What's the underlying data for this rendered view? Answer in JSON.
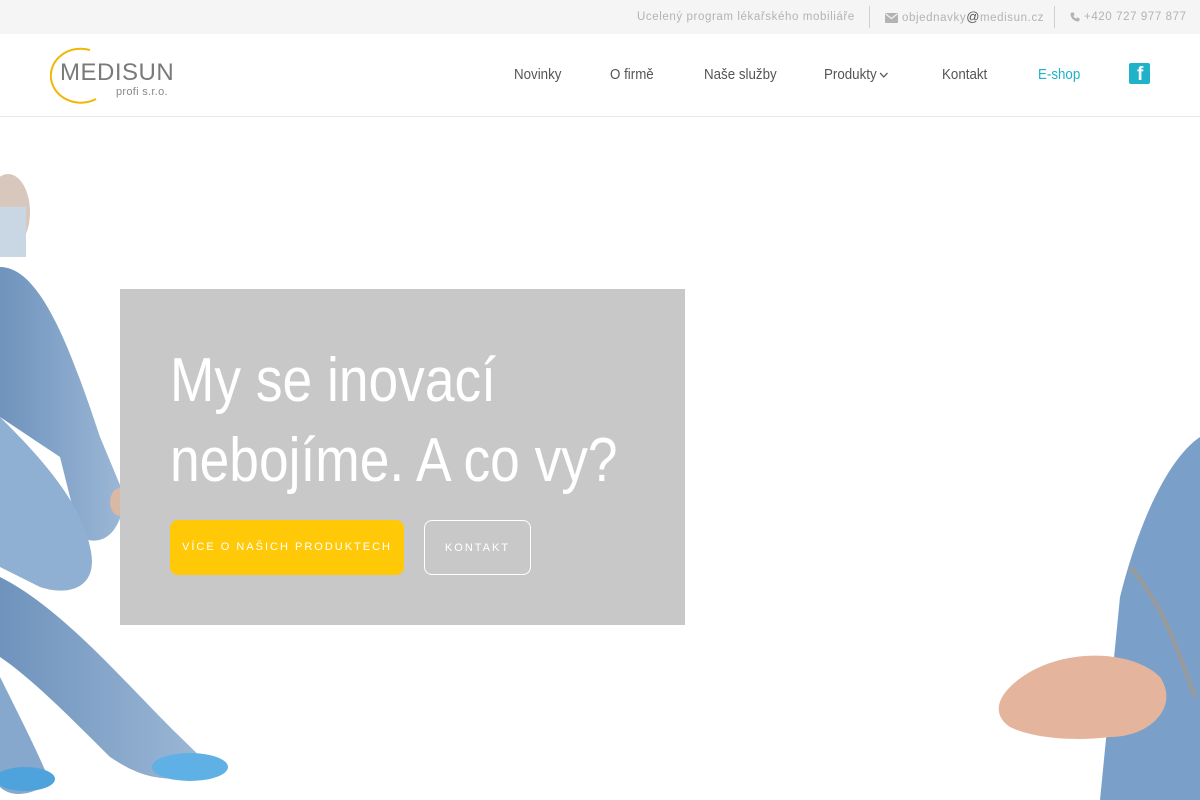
{
  "topbar": {
    "tagline": "Ucelený program lékařského mobiliáře",
    "email_user": "objednavky",
    "email_at": "@",
    "email_domain": "medisun.cz",
    "phone": "+420 727 977 877"
  },
  "logo": {
    "wordmark": "MEDISUN",
    "subtitle": "profi s.r.o."
  },
  "nav": {
    "items": [
      {
        "label": "Novinky"
      },
      {
        "label": "O firmě"
      },
      {
        "label": "Naše služby"
      },
      {
        "label": "Produkty"
      },
      {
        "label": "Kontakt"
      },
      {
        "label": "E-shop"
      }
    ]
  },
  "social": {
    "facebook_glyph": "f"
  },
  "hero": {
    "headline_line1": "My se inovací",
    "headline_line2": "nebojíme. A co vy?",
    "primary_button": "Více o našich produktech",
    "secondary_button": "Kontakt"
  },
  "colors": {
    "accent": "#1fb2c9",
    "button_yellow": "#ffc907",
    "panel_gray": "#c8c8c8",
    "scrubs_blue": "#7fa3c9"
  },
  "icons": [
    "envelope-icon",
    "phone-icon",
    "chevron-down-icon",
    "facebook-icon"
  ]
}
